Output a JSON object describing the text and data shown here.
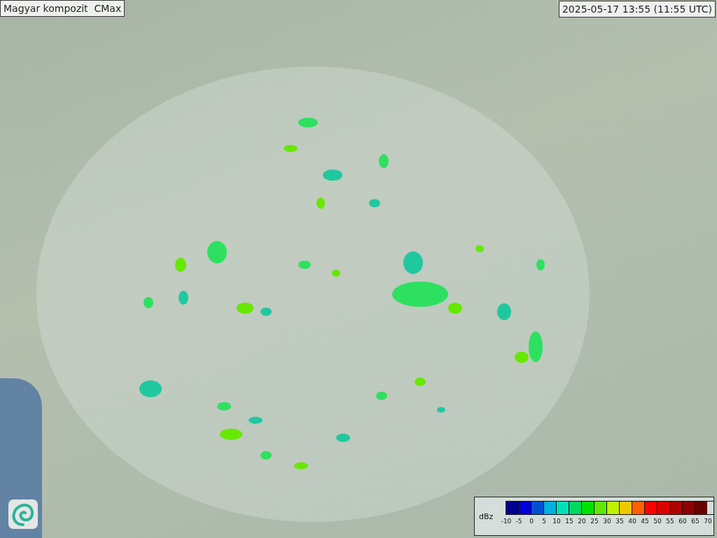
{
  "title": "Magyar kompozit  CMax",
  "timestamp": "2025-05-17 13:55 (11:55 UTC)",
  "legend": {
    "unit": "dBz",
    "swatches": [
      {
        "color": "#000090"
      },
      {
        "color": "#0000d8"
      },
      {
        "color": "#0050d0"
      },
      {
        "color": "#00b0e0"
      },
      {
        "color": "#00e0b8"
      },
      {
        "color": "#00d860"
      },
      {
        "color": "#00e000"
      },
      {
        "color": "#60e800"
      },
      {
        "color": "#c0f000"
      },
      {
        "color": "#f0c800"
      },
      {
        "color": "#ff6000"
      },
      {
        "color": "#ff0000"
      },
      {
        "color": "#d80000"
      },
      {
        "color": "#b00000"
      },
      {
        "color": "#900000"
      },
      {
        "color": "#680000"
      }
    ],
    "ticks": [
      "-10",
      "-5",
      "0",
      "5",
      "10",
      "15",
      "20",
      "25",
      "30",
      "35",
      "40",
      "45",
      "50",
      "55",
      "60",
      "65",
      "70"
    ]
  }
}
